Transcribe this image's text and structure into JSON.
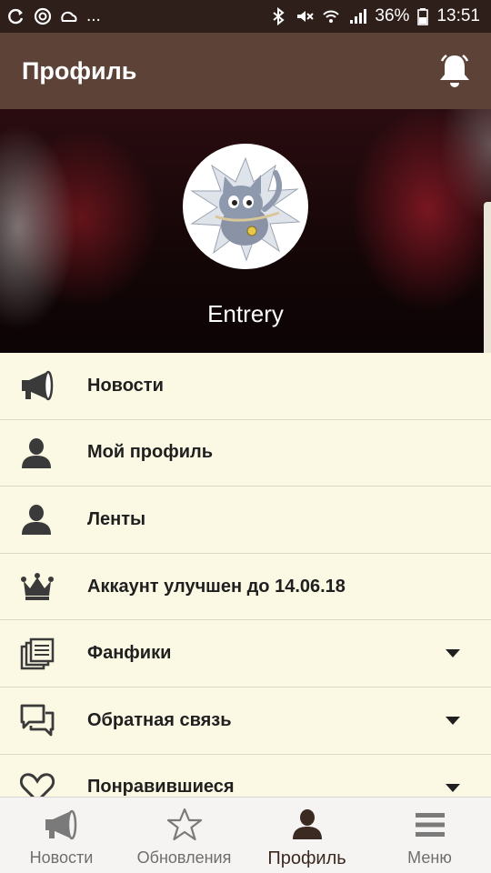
{
  "status_bar": {
    "ellipsis": "...",
    "battery": "36%",
    "time": "13:51"
  },
  "app_bar": {
    "title": "Профиль"
  },
  "profile": {
    "username": "Entrery"
  },
  "menu": {
    "items": [
      {
        "label": "Новости",
        "icon": "megaphone-icon",
        "expandable": false
      },
      {
        "label": "Мой профиль",
        "icon": "person-icon",
        "expandable": false
      },
      {
        "label": "Ленты",
        "icon": "person-icon",
        "expandable": false
      },
      {
        "label": "Аккаунт улучшен до 14.06.18",
        "icon": "crown-icon",
        "expandable": false
      },
      {
        "label": "Фанфики",
        "icon": "documents-icon",
        "expandable": true
      },
      {
        "label": "Обратная связь",
        "icon": "chat-icon",
        "expandable": true
      },
      {
        "label": "Понравившиеся",
        "icon": "heart-icon",
        "expandable": true
      }
    ]
  },
  "bottom_nav": {
    "items": [
      {
        "label": "Новости",
        "icon": "megaphone-icon",
        "active": false
      },
      {
        "label": "Обновления",
        "icon": "star-icon",
        "active": false
      },
      {
        "label": "Профиль",
        "icon": "person-icon",
        "active": true
      },
      {
        "label": "Меню",
        "icon": "hamburger-icon",
        "active": false
      }
    ]
  },
  "colors": {
    "status_bar": "#2e1f1a",
    "app_bar": "#5d4337",
    "list_bg": "#fbf8e3",
    "active_nav": "#3b2a22"
  }
}
